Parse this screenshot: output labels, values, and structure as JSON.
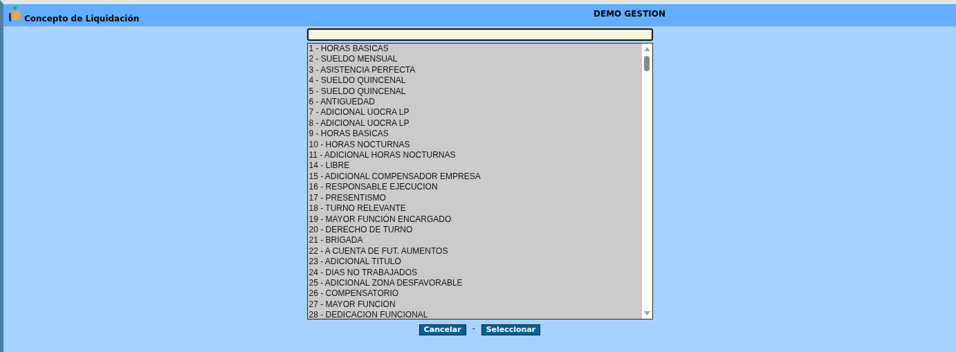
{
  "window": {
    "title": "Concepto de Liquidación",
    "company": "DEMO GESTION"
  },
  "list": {
    "items": [
      {
        "label": "1 - HORAS BASICAS",
        "selected": false
      },
      {
        "label": "2 - SUELDO MENSUAL",
        "selected": false
      },
      {
        "label": "3 - ASISTENCIA PERFECTA",
        "selected": false
      },
      {
        "label": "4 - SUELDO QUINCENAL",
        "selected": false
      },
      {
        "label": "5 - SUELDO QUINCENAL",
        "selected": false
      },
      {
        "label": "6 - ANTIGUEDAD",
        "selected": false
      },
      {
        "label": "7 - ADICIONAL UOCRA LP",
        "selected": false
      },
      {
        "label": "8 - ADICIONAL UOCRA LP",
        "selected": false
      },
      {
        "label": "9 - HORAS BASICAS",
        "selected": false
      },
      {
        "label": "10 - HORAS NOCTURNAS",
        "selected": false
      },
      {
        "label": "11 - ADICIONAL HORAS NOCTURNAS",
        "selected": false
      },
      {
        "label": "14 - LIBRE",
        "selected": false
      },
      {
        "label": "15 - ADICIONAL COMPENSADOR EMPRESA",
        "selected": false
      },
      {
        "label": "16 - RESPONSABLE EJECUCION",
        "selected": false
      },
      {
        "label": "17 - PRESENTISMO",
        "selected": false
      },
      {
        "label": "18 - TURNO RELEVANTE",
        "selected": false
      },
      {
        "label": "19 - MAYOR FUNCIÓN ENCARGADO",
        "selected": false
      },
      {
        "label": "20 - DERECHO DE TURNO",
        "selected": false
      },
      {
        "label": "21 - BRIGADA",
        "selected": false
      },
      {
        "label": "22 - A CUENTA DE FUT. AUMENTOS",
        "selected": false
      },
      {
        "label": "23 - ADICIONAL TITULO",
        "selected": false
      },
      {
        "label": "24 - DIAS NO TRABAJADOS",
        "selected": false
      },
      {
        "label": "25 - ADICIONAL ZONA DESFAVORABLE",
        "selected": false
      },
      {
        "label": "26 - COMPENSATORIO",
        "selected": false
      },
      {
        "label": "27 - MAYOR FUNCION",
        "selected": false
      },
      {
        "label": "28 - DEDICACION FUNCIONAL",
        "selected": false
      }
    ]
  },
  "buttons": {
    "cancel": "Cancelar",
    "separator": "-",
    "select": "Seleccionar"
  }
}
